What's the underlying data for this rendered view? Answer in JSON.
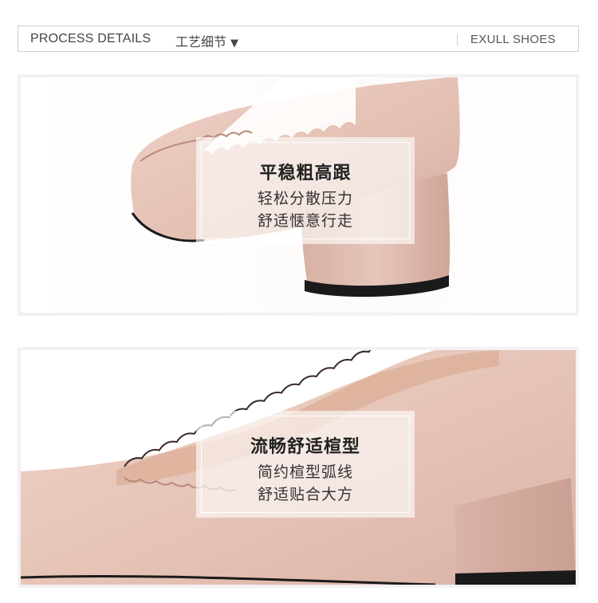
{
  "header": {
    "title_en": "PROCESS DETAILS",
    "title_cn": "工艺细节",
    "caret": "▼",
    "brand": "EXULL SHOES"
  },
  "panels": [
    {
      "heading": "平稳粗高跟",
      "lines": [
        "轻松分散压力",
        "舒适惬意行走"
      ]
    },
    {
      "heading": "流畅舒适楦型",
      "lines": [
        "简约楦型弧线",
        "舒适贴合大方"
      ]
    }
  ],
  "colors": {
    "suede": "#e6c4b8",
    "suede_shadow": "#c99f92",
    "sole": "#1a1a1a",
    "lining": "#d9a98e"
  }
}
